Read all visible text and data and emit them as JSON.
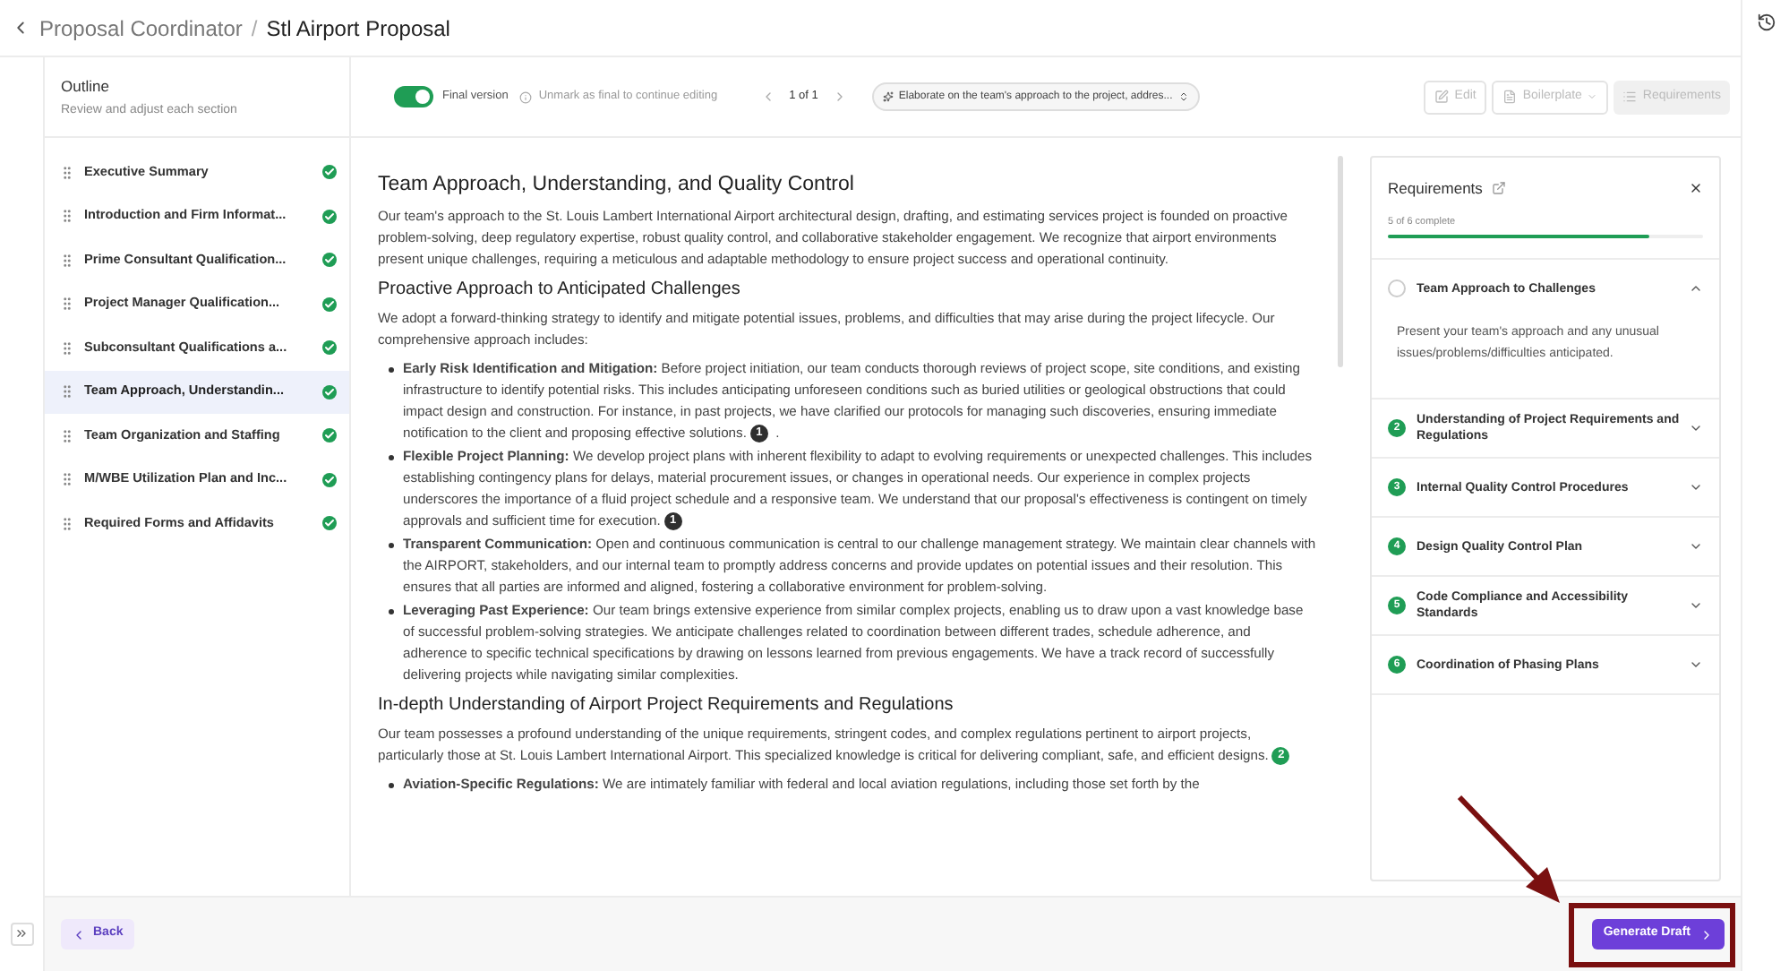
{
  "breadcrumb": {
    "parent": "Proposal Coordinator",
    "separator": "/",
    "current": "Stl Airport Proposal"
  },
  "outline": {
    "title": "Outline",
    "subtitle": "Review and adjust each section",
    "items": [
      {
        "label": "Executive Summary",
        "selected": false,
        "complete": true
      },
      {
        "label": "Introduction and Firm Informat...",
        "selected": false,
        "complete": true
      },
      {
        "label": "Prime Consultant Qualification...",
        "selected": false,
        "complete": true
      },
      {
        "label": "Project Manager Qualification...",
        "selected": false,
        "complete": true
      },
      {
        "label": "Subconsultant Qualifications a...",
        "selected": false,
        "complete": true
      },
      {
        "label": "Team Approach, Understandin...",
        "selected": true,
        "complete": true
      },
      {
        "label": "Team Organization and Staffing",
        "selected": false,
        "complete": true
      },
      {
        "label": "M/WBE Utilization Plan and Inc...",
        "selected": false,
        "complete": true
      },
      {
        "label": "Required Forms and Affidavits",
        "selected": false,
        "complete": true
      }
    ]
  },
  "toolbar": {
    "final_version": {
      "label": "Final version",
      "on": true
    },
    "hint": "Unmark as final to continue editing",
    "pager": "1 of 1",
    "prompt": "Elaborate on the team's approach to the project, addres...",
    "buttons": [
      {
        "label": "Edit",
        "kind": "edit",
        "disabled": true,
        "selected": false
      },
      {
        "label": "Boilerplate",
        "kind": "dropdown",
        "disabled": true,
        "selected": false
      },
      {
        "label": "Requirements",
        "kind": "list",
        "disabled": true,
        "selected": true
      }
    ]
  },
  "document": {
    "title": "Team Approach, Understanding, and Quality Control",
    "blocks": [
      {
        "kind": "paragraph",
        "text": "Our team's approach to the St. Louis Lambert International Airport architectural design, drafting, and estimating services project is founded on proactive problem-solving, deep regulatory expertise, robust quality control, and collaborative stakeholder engagement. We recognize that airport environments present unique challenges, requiring a meticulous and adaptable methodology to ensure project success and operational continuity."
      },
      {
        "kind": "heading",
        "text": "Proactive Approach to Anticipated Challenges"
      },
      {
        "kind": "paragraph",
        "text": "We adopt a forward-thinking strategy to identify and mitigate potential issues, problems, and difficulties that may arise during the project lifecycle. Our comprehensive approach includes:"
      },
      {
        "kind": "bullet",
        "text": "**Early Risk Identification and Mitigation:** Before project initiation, our team conducts thorough reviews of project scope, site conditions, and existing infrastructure to identify potential risks. This includes anticipating unforeseen conditions such as buried utilities or geological obstructions that could impact design and construction. For instance, in past projects, we have clarified our protocols for managing such discoveries, ensuring immediate notification to the client and proposing effective solutions.",
        "citation": {
          "text": "1",
          "color": "#2f2f2f"
        },
        "after": "."
      },
      {
        "kind": "bullet",
        "text": "**Flexible Project Planning:** We develop project plans with inherent flexibility to adapt to evolving requirements or unexpected challenges. This includes establishing contingency plans for delays, material procurement issues, or changes in operational needs. Our experience in complex projects underscores the importance of a fluid project schedule and a responsive team. We understand that our proposal's effectiveness is contingent on timely approvals and sufficient time for execution.",
        "citation": {
          "text": "1",
          "color": "#2f2f2f"
        }
      },
      {
        "kind": "bullet",
        "text": "**Transparent Communication:** Open and continuous communication is central to our challenge management strategy. We maintain clear channels with the AIRPORT, stakeholders, and our internal team to promptly address concerns and provide updates on potential issues and their resolution. This ensures that all parties are informed and aligned, fostering a collaborative environment for problem-solving."
      },
      {
        "kind": "bullet",
        "text": "**Leveraging Past Experience:** Our team brings extensive experience from similar complex projects, enabling us to draw upon a vast knowledge base of successful problem-solving strategies. We anticipate challenges related to coordination between different trades, schedule adherence, and adherence to specific technical specifications by drawing on lessons learned from previous engagements. We have a track record of successfully delivering projects while navigating similar complexities."
      },
      {
        "kind": "heading",
        "text": "In-depth Understanding of Airport Project Requirements and Regulations"
      },
      {
        "kind": "paragraph",
        "text": "Our team possesses a profound understanding of the unique requirements, stringent codes, and complex regulations pertinent to airport projects, particularly those at St. Louis Lambert International Airport. This specialized knowledge is critical for delivering compliant, safe, and efficient designs.",
        "citation": {
          "text": "2",
          "color": "#1f9d55"
        }
      },
      {
        "kind": "bullet",
        "text": "**Aviation-Specific Regulations:** We are intimately familiar with federal and local aviation regulations, including those set forth by the"
      }
    ]
  },
  "requirements": {
    "title": "Requirements",
    "progress_text": "5 of 6 complete",
    "level": 0.83,
    "items": [
      {
        "label": "Team Approach to Challenges",
        "complete": false,
        "expanded": true,
        "description": "Present your team's approach and any unusual issues/problems/difficulties anticipated."
      },
      {
        "number": "2",
        "label": "Understanding of Project Requirements and Regulations",
        "complete": true,
        "expanded": false
      },
      {
        "number": "3",
        "label": "Internal Quality Control Procedures",
        "complete": true,
        "expanded": false
      },
      {
        "number": "4",
        "label": "Design Quality Control Plan",
        "complete": true,
        "expanded": false
      },
      {
        "number": "5",
        "label": "Code Compliance and Accessibility Standards",
        "complete": true,
        "expanded": false
      },
      {
        "number": "6",
        "label": "Coordination of Phasing Plans",
        "complete": true,
        "expanded": false
      }
    ]
  },
  "footer": {
    "back": "Back",
    "generate": "Generate Draft"
  }
}
